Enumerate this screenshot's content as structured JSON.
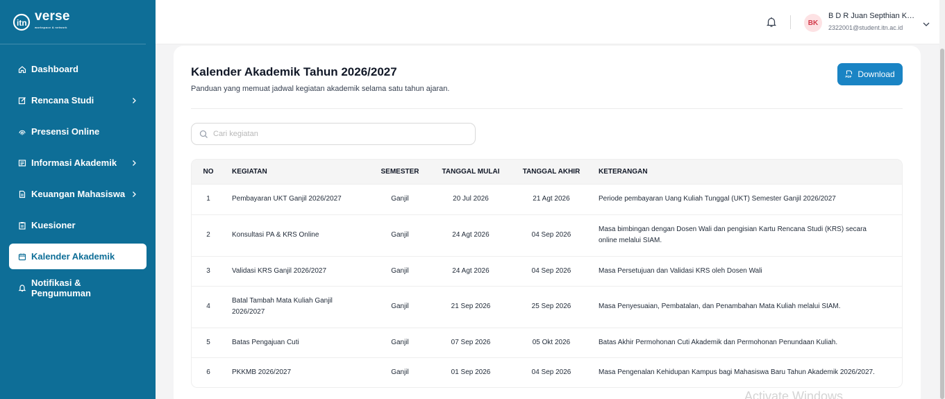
{
  "brand": {
    "logo_text": "verse",
    "logo_sub": "workspace & network"
  },
  "sidebar": {
    "items": [
      {
        "label": "Dashboard",
        "icon": "home-icon",
        "has_submenu": false,
        "active": false
      },
      {
        "label": "Rencana Studi",
        "icon": "edit-icon",
        "has_submenu": true,
        "active": false
      },
      {
        "label": "Presensi Online",
        "icon": "fingerprint-icon",
        "has_submenu": false,
        "active": false
      },
      {
        "label": "Informasi Akademik",
        "icon": "newspaper-icon",
        "has_submenu": true,
        "active": false
      },
      {
        "label": "Keuangan Mahasiswa",
        "icon": "document-icon",
        "has_submenu": true,
        "active": false
      },
      {
        "label": "Kuesioner",
        "icon": "clipboard-icon",
        "has_submenu": false,
        "active": false
      },
      {
        "label": "Kalender Akademik",
        "icon": "calendar-icon",
        "has_submenu": false,
        "active": true
      },
      {
        "label": "Notifikasi & Pengumuman",
        "icon": "bell-icon",
        "has_submenu": false,
        "active": false
      }
    ]
  },
  "topbar": {
    "user_initials": "BK",
    "user_name": "B D R Juan Septhian Kurniawan",
    "user_email": "2322001@student.itn.ac.id"
  },
  "page": {
    "title": "Kalender Akademik Tahun 2026/2027",
    "subtitle": "Panduan yang memuat jadwal kegiatan akademik selama satu tahun ajaran.",
    "download_label": "Download",
    "search_placeholder": "Cari kegiatan"
  },
  "table": {
    "headers": {
      "no": "NO",
      "kegiatan": "KEGIATAN",
      "semester": "SEMESTER",
      "mulai": "TANGGAL MULAI",
      "akhir": "TANGGAL AKHIR",
      "keterangan": "KETERANGAN"
    },
    "rows": [
      {
        "no": "1",
        "kegiatan": "Pembayaran UKT Ganjil 2026/2027",
        "semester": "Ganjil",
        "mulai": "20 Jul 2026",
        "akhir": "21 Agt 2026",
        "keterangan": "Periode pembayaran Uang Kuliah Tunggal (UKT) Semester Ganjil 2026/2027"
      },
      {
        "no": "2",
        "kegiatan": "Konsultasi PA & KRS Online",
        "semester": "Ganjil",
        "mulai": "24 Agt 2026",
        "akhir": "04 Sep 2026",
        "keterangan": "Masa bimbingan dengan Dosen Wali dan pengisian Kartu Rencana Studi (KRS) secara online melalui SIAM."
      },
      {
        "no": "3",
        "kegiatan": "Validasi KRS Ganjil 2026/2027",
        "semester": "Ganjil",
        "mulai": "24 Agt 2026",
        "akhir": "04 Sep 2026",
        "keterangan": "Masa Persetujuan dan Validasi KRS oleh Dosen Wali"
      },
      {
        "no": "4",
        "kegiatan": "Batal Tambah Mata Kuliah Ganjil 2026/2027",
        "semester": "Ganjil",
        "mulai": "21 Sep 2026",
        "akhir": "25 Sep 2026",
        "keterangan": "Masa Penyesuaian, Pembatalan, dan Penambahan Mata Kuliah melalui SIAM."
      },
      {
        "no": "5",
        "kegiatan": "Batas Pengajuan Cuti",
        "semester": "Ganjil",
        "mulai": "07 Sep 2026",
        "akhir": "05 Okt 2026",
        "keterangan": "Batas Akhir Permohonan Cuti Akademik dan Permohonan Penundaan Kuliah."
      },
      {
        "no": "6",
        "kegiatan": "PKKMB 2026/2027",
        "semester": "Ganjil",
        "mulai": "01 Sep 2026",
        "akhir": "04 Sep 2026",
        "keterangan": "Masa Pengenalan Kehidupan Kampus bagi Mahasiswa Baru Tahun Akademik 2026/2027."
      }
    ]
  },
  "watermark": "Activate Windows",
  "colors": {
    "sidebar": "#0e6e97",
    "accent": "#1a84c4",
    "avatar_bg": "#fde2e4",
    "avatar_text": "#d23b4b"
  }
}
